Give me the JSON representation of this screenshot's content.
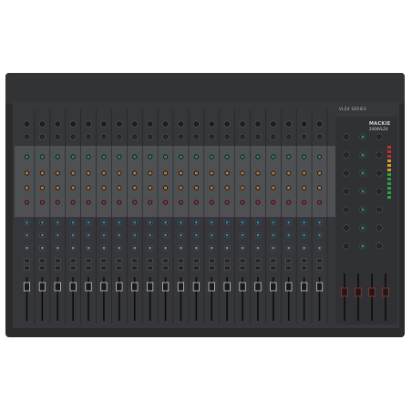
{
  "image": {
    "subject": "mixing-console",
    "brand_logo": "MACKIE",
    "model_label": "2404VLZ4",
    "series_label": "VLZ4 SERIES"
  },
  "mixer": {
    "channel_count": 16,
    "stereo_channel_count": 4,
    "colors": {
      "chassis": "#2b2b2c",
      "panel": "#3a3b3d",
      "eq_panel": "#4e5054",
      "trim_knob": "#1e1f21",
      "eq_high_cap": "#2e8c5e",
      "eq_mid_cap": "#c87a2c",
      "eq_low_cap": "#a0303a",
      "aux_cap": "#3a86a8",
      "fader_cap": "#e0e0e0"
    }
  }
}
